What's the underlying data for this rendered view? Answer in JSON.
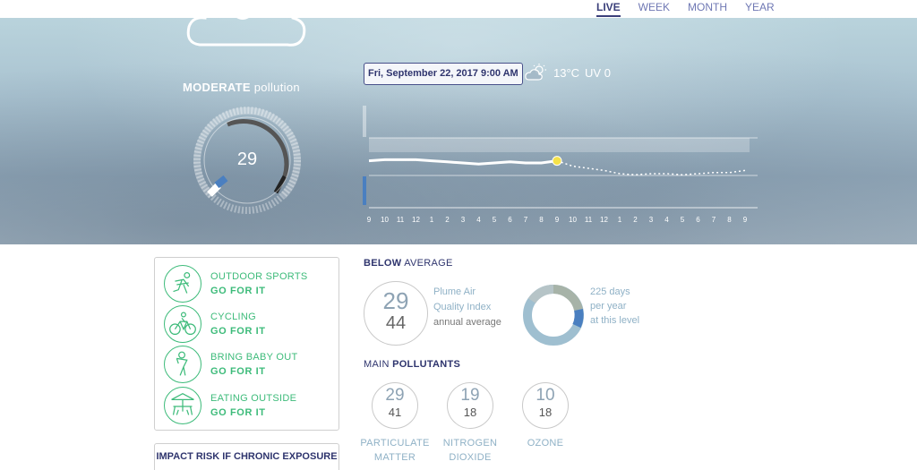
{
  "nav": {
    "tabs": [
      {
        "label": "LIVE",
        "active": true
      },
      {
        "label": "WEEK",
        "active": false
      },
      {
        "label": "MONTH",
        "active": false
      },
      {
        "label": "YEAR",
        "active": false
      }
    ]
  },
  "hero": {
    "pollution_level": "MODERATE",
    "pollution_suffix": "pollution",
    "aqi_value": "29",
    "datetime": "Fri, September 22, 2017 9:00 AM",
    "temperature": "13°C",
    "uv": "UV 0",
    "weather_icon": "partly-cloudy-icon"
  },
  "chart_data": {
    "type": "line",
    "x": [
      "9",
      "10",
      "11",
      "12",
      "1",
      "2",
      "3",
      "4",
      "5",
      "6",
      "7",
      "8",
      "9",
      "10",
      "11",
      "12",
      "1",
      "2",
      "3",
      "4",
      "5",
      "6",
      "7",
      "8",
      "9"
    ],
    "series": [
      {
        "values": [
          37,
          38,
          38,
          38,
          37,
          36,
          35,
          34,
          35,
          36,
          35,
          35,
          37,
          32,
          30,
          28,
          25,
          24,
          25,
          25,
          24,
          25,
          26,
          26,
          28
        ]
      }
    ],
    "colors": {
      "past": "#ffffff",
      "current": "#f5e24a"
    }
  },
  "activities": [
    {
      "name": "OUTDOOR SPORTS",
      "status": "GO FOR IT",
      "icon": "running-icon"
    },
    {
      "name": "CYCLING",
      "status": "GO FOR IT",
      "icon": "cycling-icon"
    },
    {
      "name": "BRING BABY OUT",
      "status": "GO FOR IT",
      "icon": "baby-icon"
    },
    {
      "name": "EATING OUTSIDE",
      "status": "GO FOR IT",
      "icon": "picnic-table-icon"
    }
  ],
  "impact": {
    "title": "IMPACT RISK IF CHRONIC EXPOSURE"
  },
  "average": {
    "title_bold": "BELOW",
    "title_rest": "AVERAGE",
    "current": "29",
    "annual": "44",
    "label_line1": "Plume Air",
    "label_line2": "Quality Index",
    "label_line3": "annual average",
    "days": "225 days",
    "days_line2": "per year",
    "days_line3": "at this level"
  },
  "pollutants": {
    "title_rest": "MAIN",
    "title_bold": "POLLUTANTS",
    "items": [
      {
        "top": "29",
        "bottom": "41",
        "name1": "PARTICULATE",
        "name2": "MATTER"
      },
      {
        "top": "19",
        "bottom": "18",
        "name1": "NITROGEN",
        "name2": "DIOXIDE"
      },
      {
        "top": "10",
        "bottom": "18",
        "name1": "OZONE",
        "name2": ""
      }
    ]
  },
  "colors": {
    "brand": "#2f356e",
    "accent_green": "#3dbb7a",
    "light_blue": "#8fb1c6"
  }
}
